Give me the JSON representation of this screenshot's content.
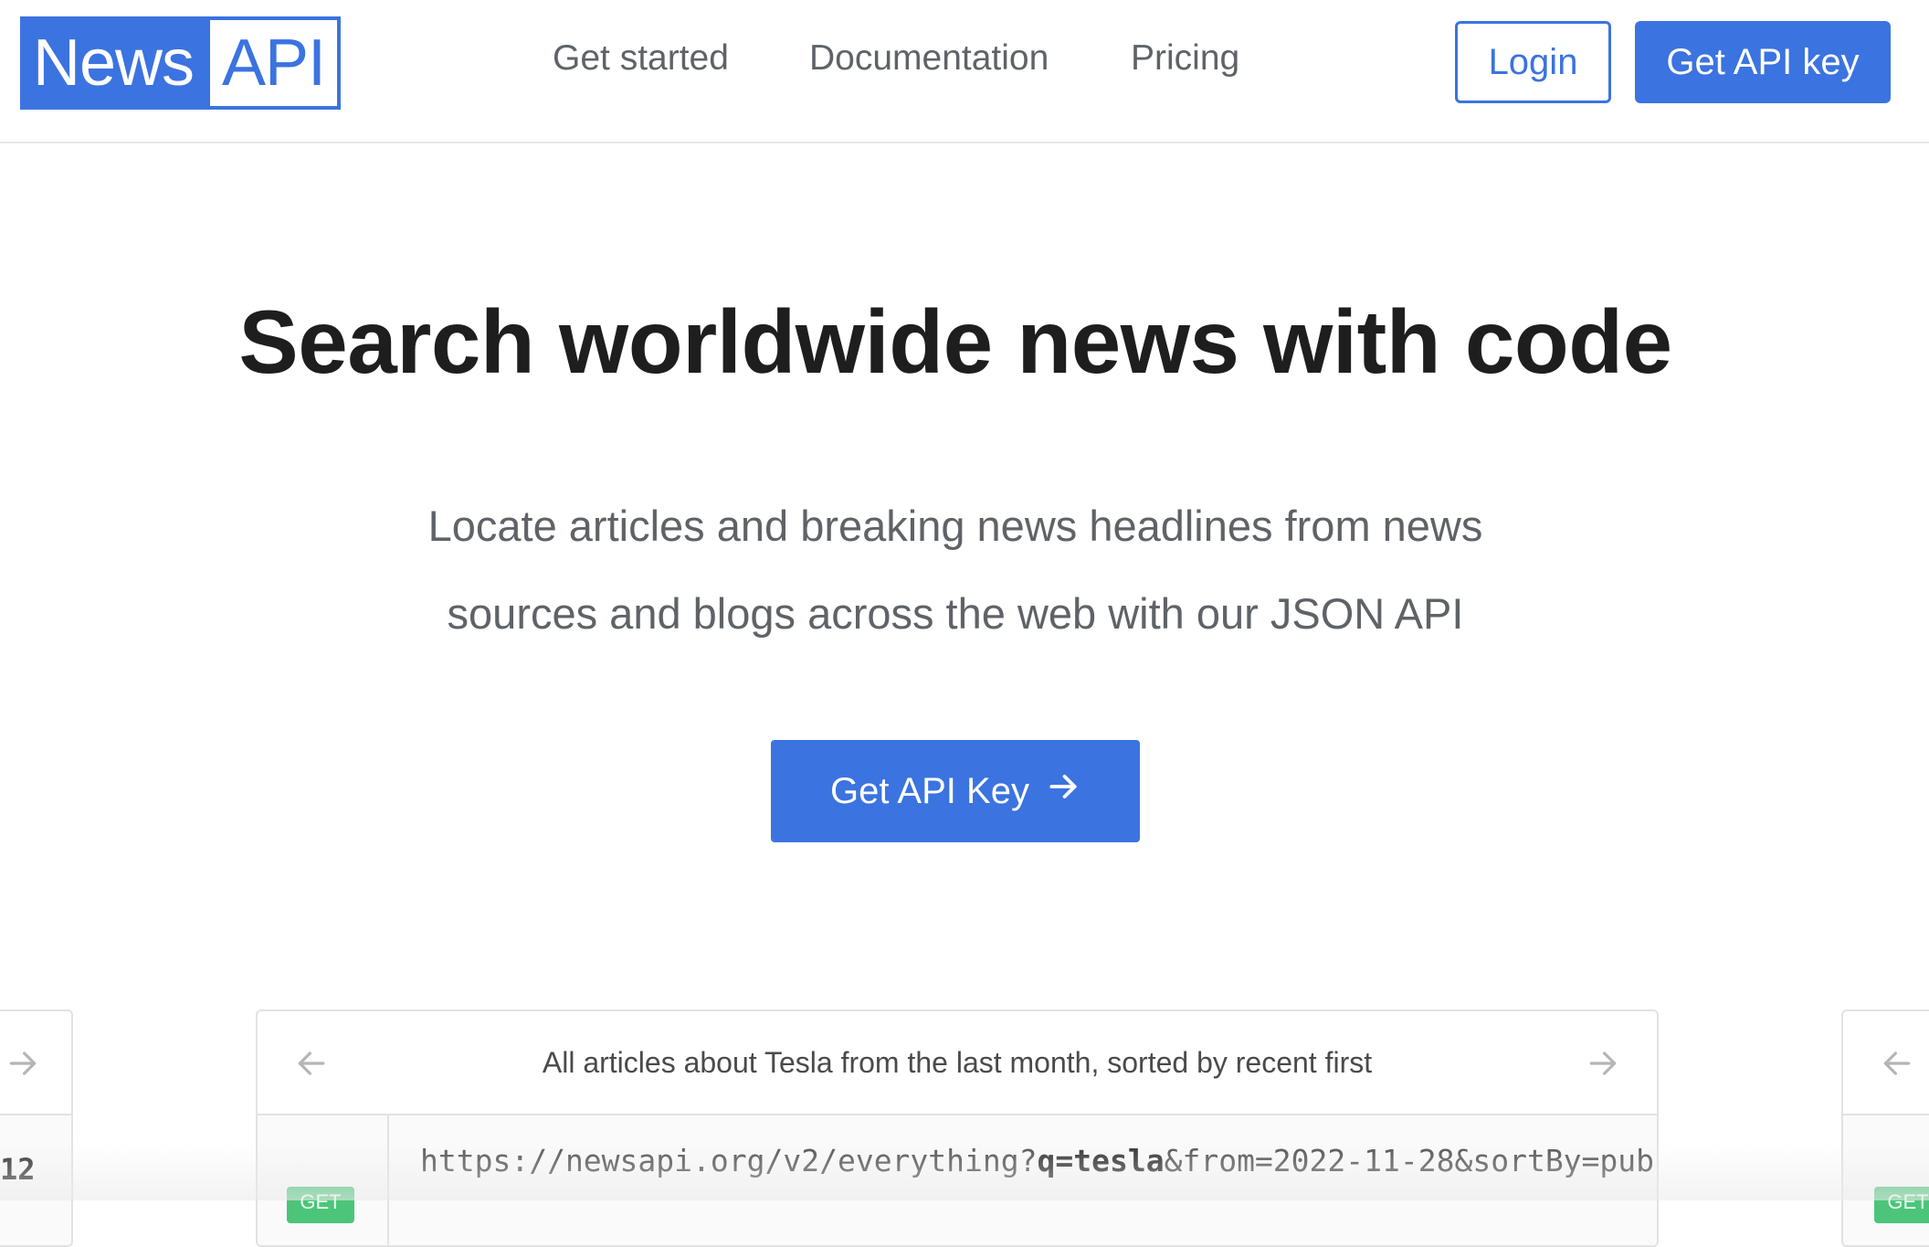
{
  "header": {
    "logo_part1": "News",
    "logo_part2": "API",
    "nav": [
      "Get started",
      "Documentation",
      "Pricing"
    ],
    "login_label": "Login",
    "get_key_label": "Get API key"
  },
  "hero": {
    "title": "Search worldwide news with code",
    "subtitle_line1": "Locate articles and breaking news headlines from news",
    "subtitle_line2": "sources and blogs across the web with our JSON API",
    "cta_label": "Get API Key",
    "cta_icon": "arrow-right-icon"
  },
  "carousel": {
    "current": {
      "title": "All articles about Tesla from the last month, sorted by recent first",
      "method": "GET",
      "url_prefix": "https://newsapi.org/v2/everything?",
      "url_bold": "q=tesla",
      "url_suffix": "&from=2022-11-28&sortBy=pub"
    },
    "left_peek_number": "12",
    "right_peek_method": "GET"
  },
  "colors": {
    "accent": "#3b73e0",
    "get_badge": "#4cc57a",
    "nav_text": "#5f6368"
  }
}
